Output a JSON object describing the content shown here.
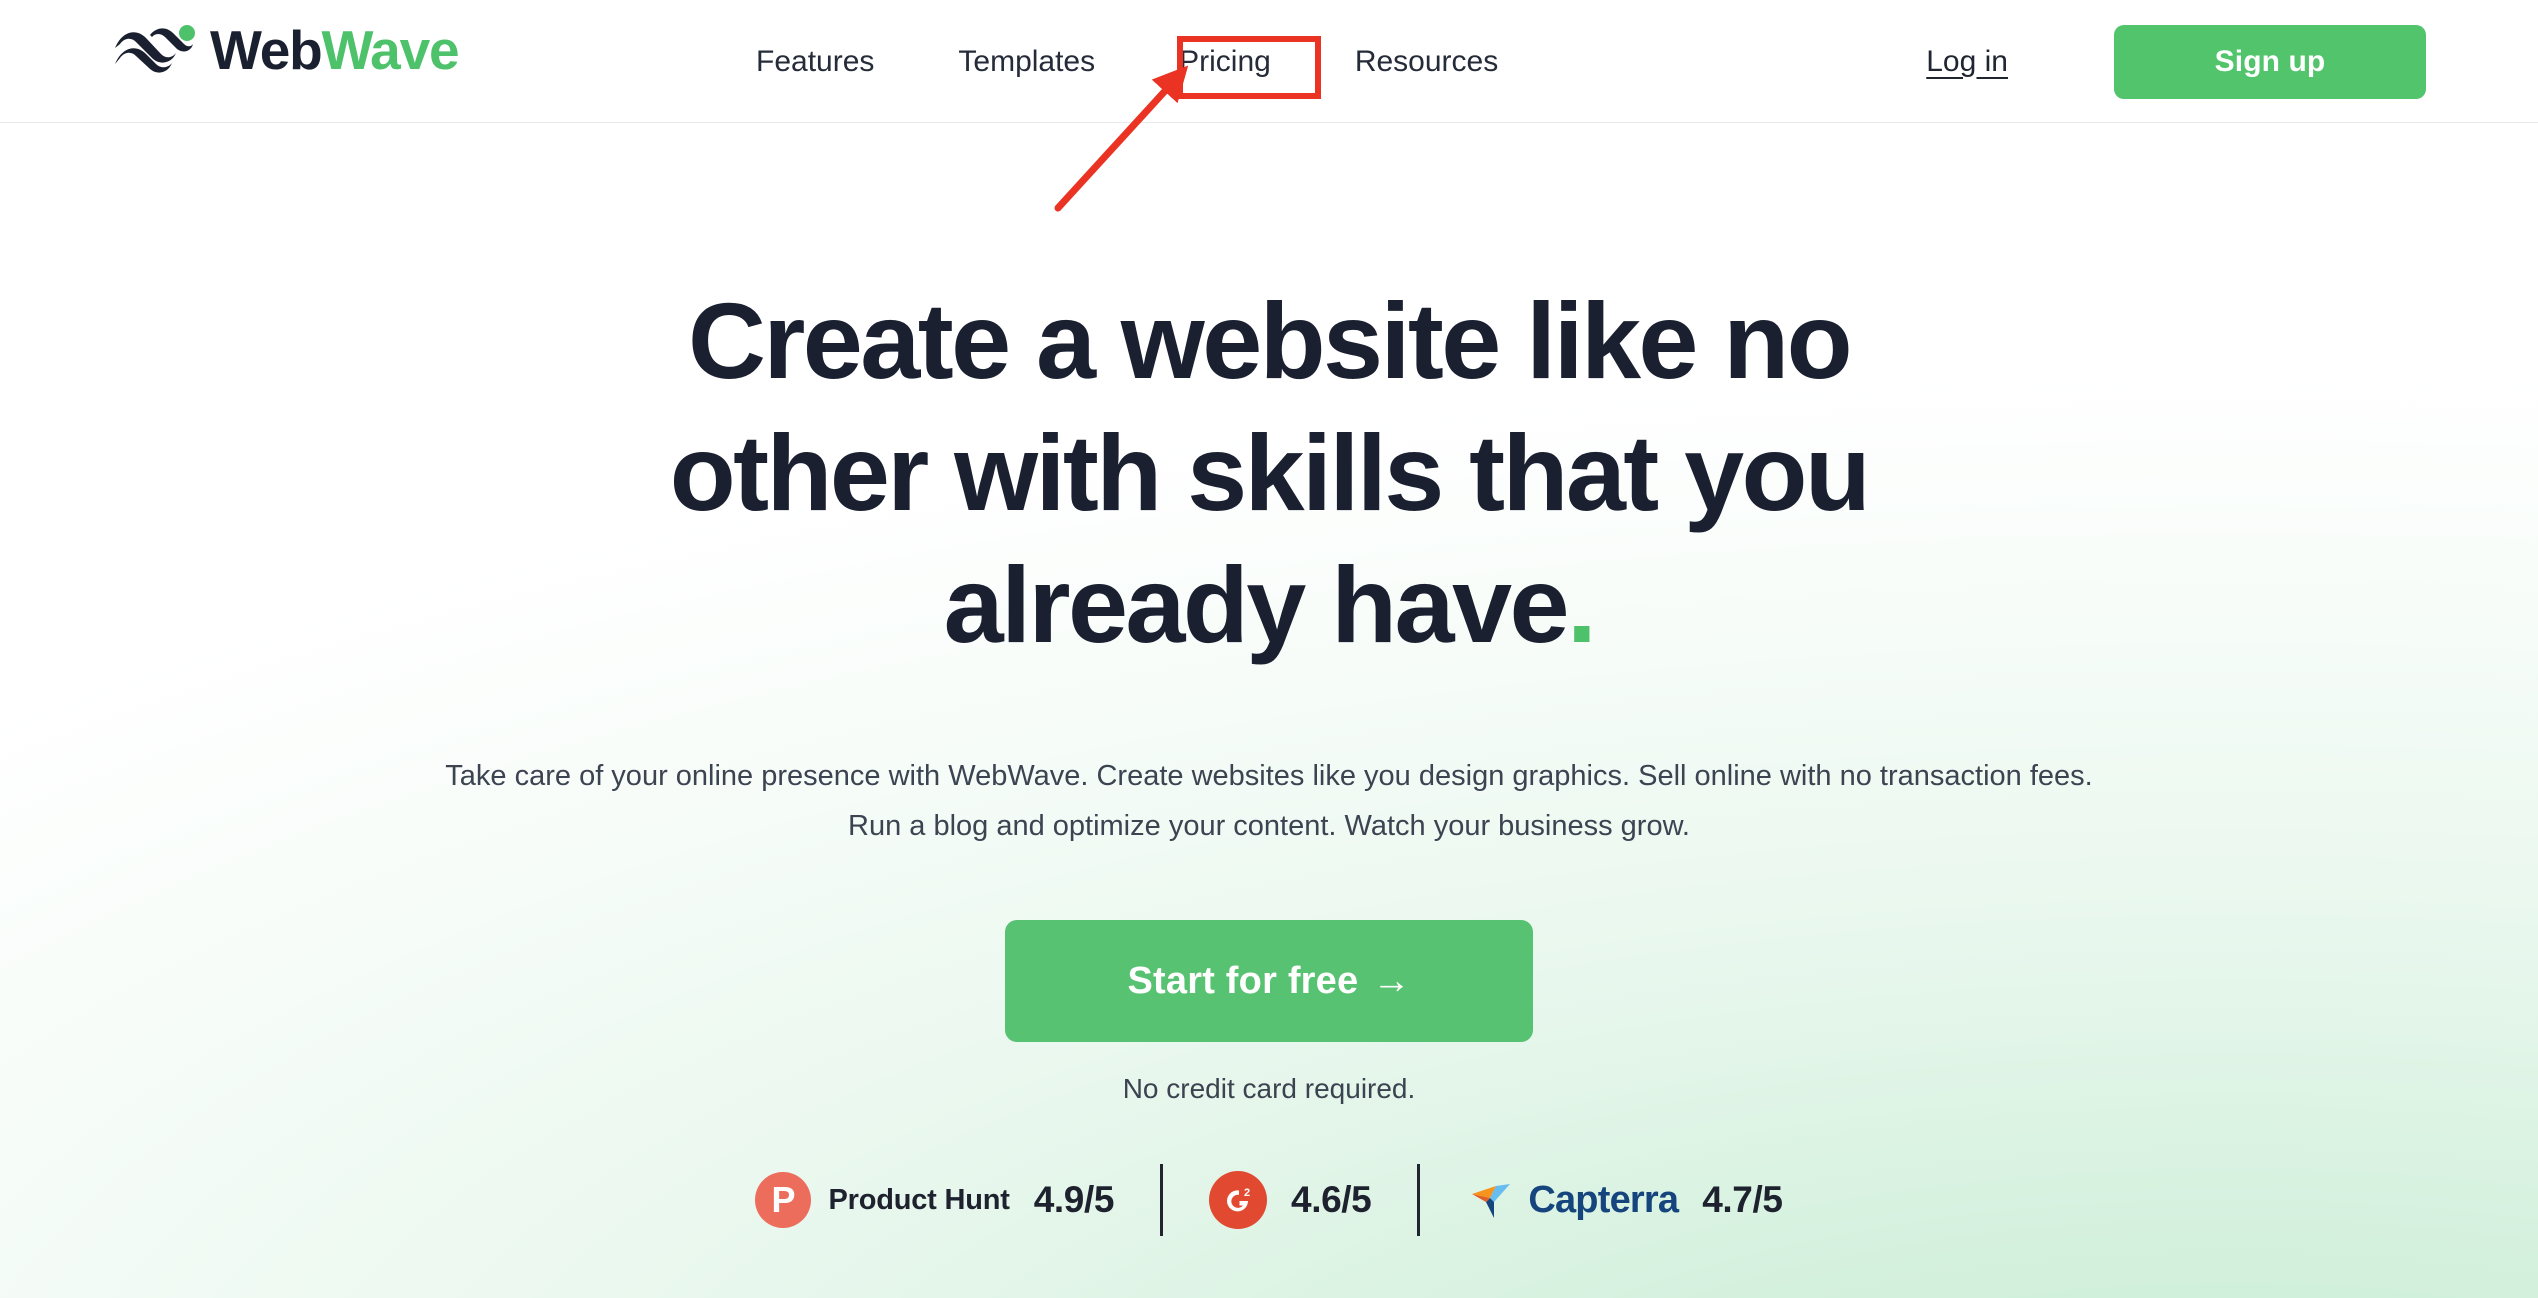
{
  "brand": {
    "name_part1": "Web",
    "name_part2": "Wave",
    "logo_icon": "wave-logo-mark",
    "accent_color": "#4ec26a",
    "dark_color": "#1b2030"
  },
  "nav": {
    "items": [
      {
        "label": "Features"
      },
      {
        "label": "Templates"
      },
      {
        "label": "Pricing"
      },
      {
        "label": "Resources"
      }
    ]
  },
  "actions": {
    "login_label": "Log in",
    "signup_label": "Sign up"
  },
  "hero": {
    "headline_line1": "Create a website like no",
    "headline_line2": "other with skills that you",
    "headline_line3": "already have",
    "headline_dot": ".",
    "subtext_line1": "Take care of your online presence with WebWave. Create websites like you design graphics. Sell online with no transaction fees.",
    "subtext_line2": "Run a blog and optimize your content. Watch your business grow.",
    "cta_label": "Start for free",
    "cta_arrow": "→",
    "cta_note": "No credit card required."
  },
  "ratings": [
    {
      "icon": "product-hunt-icon",
      "icon_glyph": "P",
      "name": "Product Hunt",
      "score": "4.9/5",
      "icon_color": "#ec6d5b"
    },
    {
      "icon": "g2-icon",
      "icon_glyph": "G2",
      "name": "",
      "score": "4.6/5",
      "icon_color": "#e14a30"
    },
    {
      "icon": "capterra-icon",
      "icon_glyph": "",
      "name": "Capterra",
      "score": "4.7/5",
      "icon_color": "#16457e"
    }
  ],
  "annotation": {
    "target": "Pricing",
    "color": "#ea3323",
    "shape": "rectangle-with-arrow"
  }
}
